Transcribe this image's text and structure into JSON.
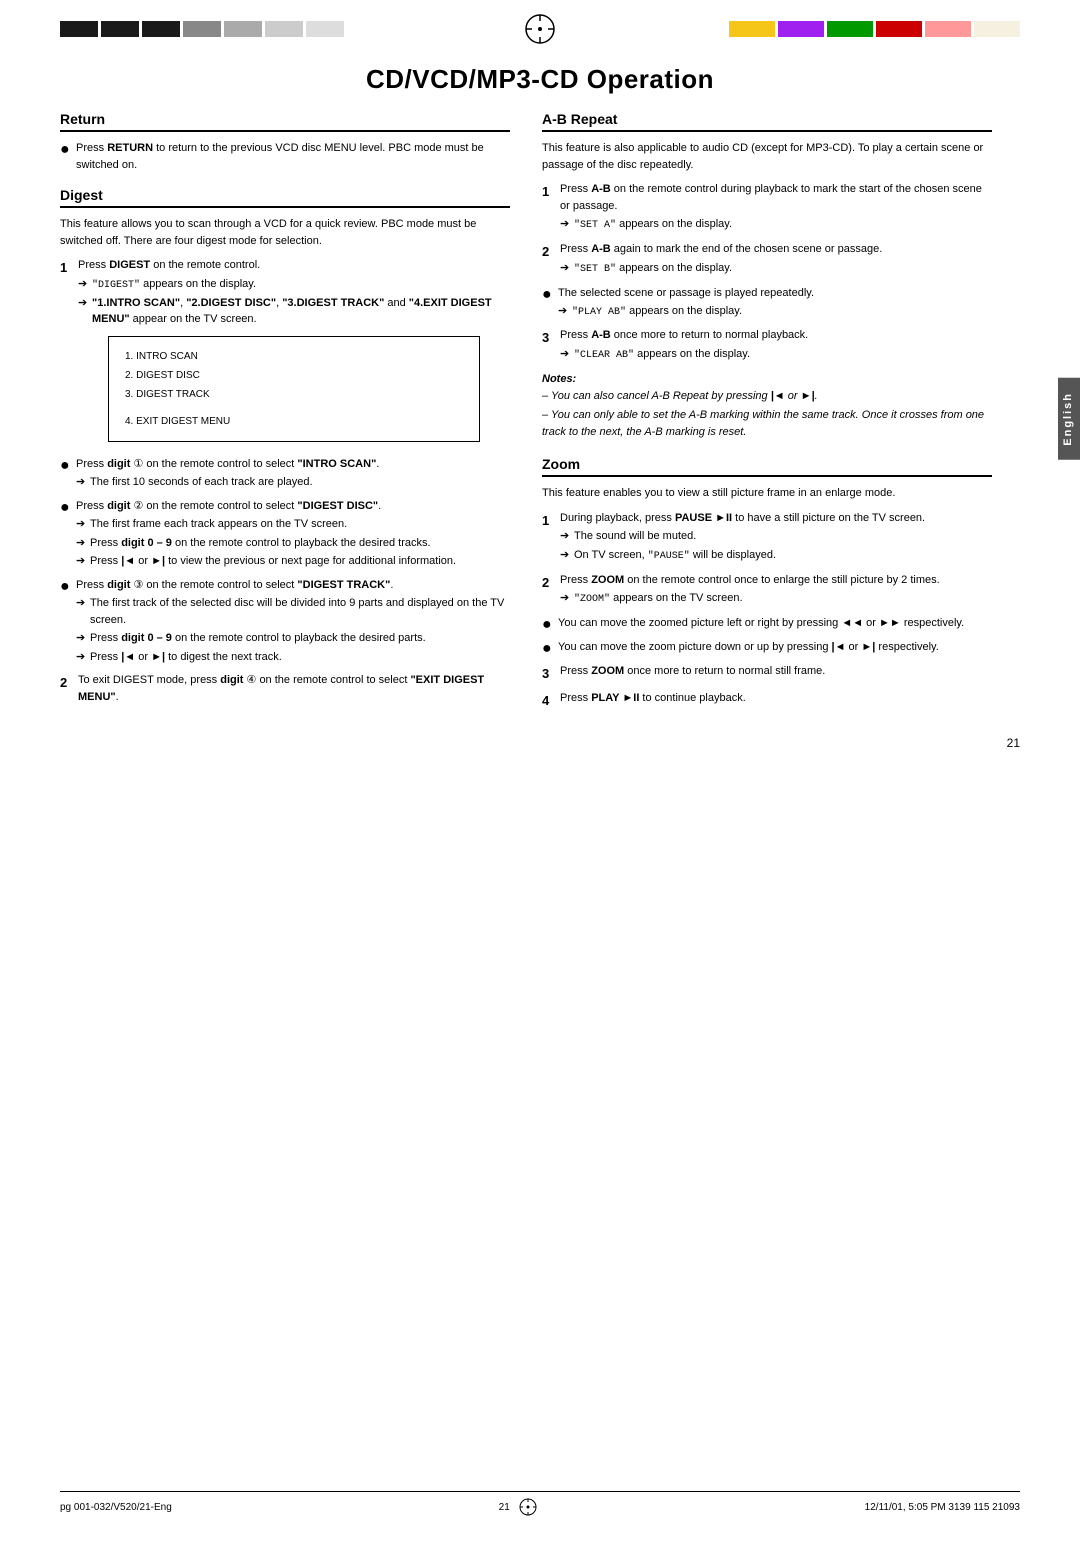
{
  "page": {
    "title": "CD/VCD/MP3-CD Operation",
    "number": "21",
    "bottom_left": "pg 001-032/V520/21-Eng",
    "bottom_center": "21",
    "bottom_right": "12/11/01, 5:05 PM  3139 115 21093",
    "english_tab": "English"
  },
  "top_bar": {
    "left_colors": [
      "#1a1a1a",
      "#1a1a1a",
      "#1a1a1a",
      "#888",
      "#888",
      "#888",
      "#888",
      "#888"
    ],
    "right_colors": [
      "#f5c518",
      "#a020f0",
      "#009900",
      "#cc0000",
      "#ff69b4",
      "#f5f5dc"
    ]
  },
  "return_section": {
    "title": "Return",
    "bullet": "Press RETURN to return to the previous VCD disc MENU level. PBC mode must be switched on."
  },
  "digest_section": {
    "title": "Digest",
    "intro": "This feature allows you to scan through a VCD for a quick review. PBC mode must be switched off. There are four digest mode for selection.",
    "step1": {
      "num": "1",
      "text": "Press DIGEST on the remote control.",
      "arrow1": "\"DIGEST\" appears on the display.",
      "arrow2": "\"1.INTRO SCAN\", \"2.DIGEST DISC\", \"3.DIGEST TRACK\" and \"4.EXIT DIGEST MENU\" appear on the TV screen."
    },
    "menu_items": [
      "1.  INTRO SCAN",
      "2.  DIGEST DISC",
      "3.  DIGEST TRACK",
      "4.  EXIT DIGEST MENU"
    ],
    "bullet1": {
      "text": "Press digit ① on the remote control to select \"INTRO SCAN\".",
      "arrow": "The first 10 seconds of each track are played."
    },
    "bullet2": {
      "text": "Press digit ② on the remote control to select \"DIGEST DISC\".",
      "arrow1": "The first frame each track appears on the TV screen.",
      "arrow2": "Press digit 0 – 9 on the remote control to playback the desired tracks.",
      "arrow3": "Press |◄ or ►| to view the previous or next page for additional information."
    },
    "bullet3": {
      "text": "Press digit ③ on the remote control to select \"DIGEST TRACK\".",
      "arrow1": "The first track of the selected disc will be divided into 9 parts and displayed on the TV screen.",
      "arrow2": "Press digit 0 – 9 on the remote control to playback the desired parts.",
      "arrow3": "Press |◄ or ►| to digest the next track."
    },
    "step2": {
      "num": "2",
      "text": "To exit DIGEST mode, press digit ④ on the remote control to select \"EXIT DIGEST MENU\"."
    }
  },
  "ab_repeat_section": {
    "title": "A-B Repeat",
    "intro": "This feature is also applicable to audio CD (except for MP3-CD). To play a certain scene or passage of the disc repeatedly.",
    "step1": {
      "num": "1",
      "text": "Press A-B on the remote control during playback to mark the start of the chosen scene or passage.",
      "arrow": "\"SET A\" appears on the display."
    },
    "step2": {
      "num": "2",
      "text": "Press A-B again to mark the end of the chosen scene or passage.",
      "arrow": "\"SET B\" appears on the display."
    },
    "bullet1": {
      "text": "The selected scene or passage is played repeatedly.",
      "arrow": "\"PLAY AB\" appears on the display."
    },
    "step3": {
      "num": "3",
      "text": "Press A-B once more to return to normal playback.",
      "arrow": "\"CLEAR AB\" appears on the display."
    },
    "notes_title": "Notes:",
    "note1": "– You can also cancel A-B Repeat by pressing |◄ or ►|.",
    "note2": "– You can only able to set the A-B marking within the same track. Once it crosses from one track to the next, the A-B marking is reset."
  },
  "zoom_section": {
    "title": "Zoom",
    "intro": "This feature enables you to view a still picture frame in an enlarge mode.",
    "step1": {
      "num": "1",
      "text": "During playback, press PAUSE ►II to have a still picture on the TV screen.",
      "arrow1": "The sound will be muted.",
      "arrow2": "On TV screen, \"PAUSE\" will be displayed."
    },
    "step2": {
      "num": "2",
      "text": "Press ZOOM on the remote control once to enlarge the still picture by 2 times.",
      "arrow": "\"ZOOM\" appears on the TV screen."
    },
    "bullet1": "You can move the zoomed picture left or right by pressing ◄◄ or ►► respectively.",
    "bullet2": "You can move the zoom picture down or up by pressing |◄ or ►| respectively.",
    "step3": {
      "num": "3",
      "text": "Press ZOOM once more to return to normal still frame."
    },
    "step4": {
      "num": "4",
      "text": "Press PLAY ►II to continue playback."
    }
  }
}
